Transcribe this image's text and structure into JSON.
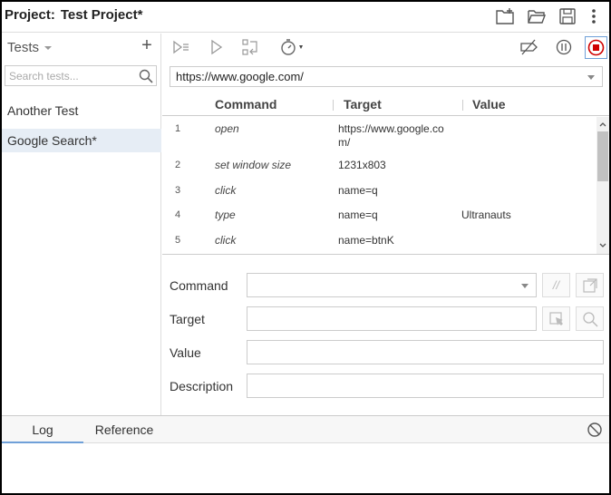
{
  "header": {
    "project_label": "Project:",
    "project_name": "Test Project*"
  },
  "sidebar": {
    "tests_label": "Tests",
    "add_label": "+",
    "search_placeholder": "Search tests...",
    "items": [
      {
        "label": "Another Test",
        "selected": false
      },
      {
        "label": "Google Search*",
        "selected": true
      }
    ]
  },
  "main": {
    "url": "https://www.google.com/",
    "table": {
      "headers": [
        "Command",
        "Target",
        "Value"
      ],
      "rows": [
        {
          "num": "1",
          "command": "open",
          "target": "https://www.google.com/",
          "value": ""
        },
        {
          "num": "2",
          "command": "set window size",
          "target": "1231x803",
          "value": ""
        },
        {
          "num": "3",
          "command": "click",
          "target": "name=q",
          "value": ""
        },
        {
          "num": "4",
          "command": "type",
          "target": "name=q",
          "value": "Ultranauts"
        },
        {
          "num": "5",
          "command": "click",
          "target": "name=btnK",
          "value": ""
        }
      ]
    },
    "editor": {
      "command_label": "Command",
      "target_label": "Target",
      "value_label": "Value",
      "description_label": "Description",
      "comment_label": "//"
    }
  },
  "bottom": {
    "tabs": [
      "Log",
      "Reference"
    ],
    "active_tab": "Log"
  },
  "colors": {
    "accent": "#6fa0d8",
    "record": "#d00000",
    "selected_bg": "#e6edf5"
  }
}
